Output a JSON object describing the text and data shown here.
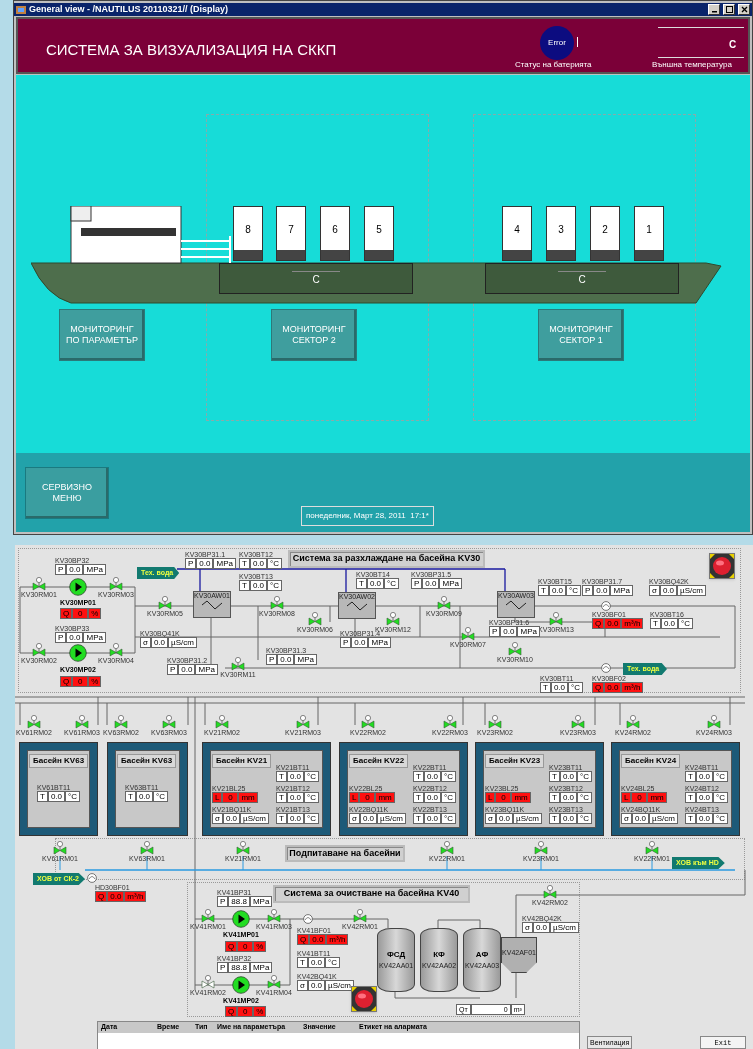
{
  "window": {
    "title": "General view - /NAUTILUS 20110321// (Display)"
  },
  "header": {
    "title": "СИСТЕМА ЗА ВИЗУАЛИЗАЦИЯ НА СККП",
    "battery": {
      "status": "Error",
      "label": "Статус на батерията"
    },
    "outside_temp": {
      "value": "C",
      "label": "Външна температура"
    }
  },
  "ship": {
    "containers": [
      {
        "number": "8"
      },
      {
        "number": "7"
      },
      {
        "number": "6"
      },
      {
        "number": "5"
      },
      {
        "number": "4"
      },
      {
        "number": "3"
      },
      {
        "number": "2"
      },
      {
        "number": "1"
      }
    ],
    "sector_readings": [
      "C",
      "C"
    ]
  },
  "monitor_buttons": [
    "МОНИТОРИНГ ПО ПАРАМЕТЪР",
    "МОНИТОРИНГ СЕКТОР 2",
    "МОНИТОРИНГ СЕКТОР 1"
  ],
  "service_button": "СЕРВИЗНО МЕНЮ",
  "datetime": "понеделник, Март 28, 2011  17:1*",
  "cooling": {
    "title": "Система за разхлаждане на басейна KV30",
    "tech_water": [
      "Тех. вода",
      "Тех. вода"
    ],
    "pumps": [
      {
        "tag": "KV30MP01",
        "running": true,
        "reading": {
          "symbol": "Q",
          "value": "0",
          "unit": "%",
          "alarm": true
        }
      },
      {
        "tag": "KV30MP02",
        "running": true,
        "reading": {
          "symbol": "Q",
          "value": "0",
          "unit": "%",
          "alarm": true
        }
      }
    ],
    "exchangers": [
      "KV30AW01",
      "KV30AW02",
      "KV30AW03"
    ],
    "valves": [
      {
        "tag": "KV30RM01",
        "open": true
      },
      {
        "tag": "KV30RM03",
        "open": true
      },
      {
        "tag": "KV30RM02",
        "open": true
      },
      {
        "tag": "KV30RM04",
        "open": true
      },
      {
        "tag": "KV30RM05",
        "open": true
      },
      {
        "tag": "KV30RM08",
        "open": true
      },
      {
        "tag": "KV30RM06",
        "open": true
      },
      {
        "tag": "KV30RM11",
        "open": true
      },
      {
        "tag": "KV30RM12",
        "open": true
      },
      {
        "tag": "KV30RM09",
        "open": true
      },
      {
        "tag": "KV30RM07",
        "open": true
      },
      {
        "tag": "KV30RM10",
        "open": true
      },
      {
        "tag": "KV30RM13",
        "open": true
      }
    ],
    "readouts": [
      {
        "tag": "KV30BP32",
        "symbol": "P",
        "value": "0.0",
        "unit": "MPa",
        "alarm": false
      },
      {
        "tag": "KV30BP33",
        "symbol": "P",
        "value": "0.0",
        "unit": "MPa",
        "alarm": false
      },
      {
        "tag": "KV30BQ41K",
        "symbol": "σ",
        "value": "0.0",
        "unit": "µS/cm",
        "alarm": false
      },
      {
        "tag": "KV30BP31.1",
        "symbol": "P",
        "value": "0.0",
        "unit": "MPa",
        "alarm": false
      },
      {
        "tag": "KV30BT12",
        "symbol": "T",
        "value": "0.0",
        "unit": "°C",
        "alarm": false
      },
      {
        "tag": "KV30BT13",
        "symbol": "T",
        "value": "0.0",
        "unit": "°C",
        "alarm": false
      },
      {
        "tag": "KV30BP31.2",
        "symbol": "P",
        "value": "0.0",
        "unit": "MPa",
        "alarm": false
      },
      {
        "tag": "KV30BP31.3",
        "symbol": "P",
        "value": "0.0",
        "unit": "MPa",
        "alarm": false
      },
      {
        "tag": "KV30BT14",
        "symbol": "T",
        "value": "0.0",
        "unit": "°C",
        "alarm": false
      },
      {
        "tag": "KV30BP31.4",
        "symbol": "P",
        "value": "0.0",
        "unit": "MPa",
        "alarm": false
      },
      {
        "tag": "KV30BP31.5",
        "symbol": "P",
        "value": "0.0",
        "unit": "MPa",
        "alarm": false
      },
      {
        "tag": "KV30BT15",
        "symbol": "T",
        "value": "0.0",
        "unit": "°C",
        "alarm": false
      },
      {
        "tag": "KV30BP31.7",
        "symbol": "P",
        "value": "0.0",
        "unit": "MPa",
        "alarm": false
      },
      {
        "tag": "KV30BQ42K",
        "symbol": "σ",
        "value": "0.0",
        "unit": "µS/cm",
        "alarm": false
      },
      {
        "tag": "KV30BP31.6",
        "symbol": "P",
        "value": "0.0",
        "unit": "MPa",
        "alarm": false
      },
      {
        "tag": "KV30BF01",
        "symbol": "Q",
        "value": "0.0",
        "unit": "m³/h",
        "alarm": true
      },
      {
        "tag": "KV30BT16",
        "symbol": "T",
        "value": "0.0",
        "unit": "°C",
        "alarm": false
      },
      {
        "tag": "KV30BT11",
        "symbol": "T",
        "value": "0.0",
        "unit": "°C",
        "alarm": false
      },
      {
        "tag": "KV30BF02",
        "symbol": "Q",
        "value": "0.0",
        "unit": "m³/h",
        "alarm": true
      }
    ]
  },
  "pools": {
    "title": "Подпитаване на басейни",
    "inlet": "ХОВ от СК-2",
    "outlet": "ХОВ към HD",
    "basins": [
      {
        "kind": "small",
        "title": "Басейн KV63",
        "readouts": [
          {
            "tag": "KV61BT11",
            "symbol": "T",
            "value": "0.0",
            "unit": "°C",
            "alarm": false
          }
        ]
      },
      {
        "kind": "small",
        "title": "Басейн KV63",
        "readouts": [
          {
            "tag": "KV63BT11",
            "symbol": "T",
            "value": "0.0",
            "unit": "°C",
            "alarm": false
          }
        ]
      },
      {
        "kind": "large",
        "title": "Басейн KV21",
        "readouts": [
          {
            "tag": "KV21BT11",
            "symbol": "T",
            "value": "0.0",
            "unit": "°C",
            "alarm": false
          },
          {
            "tag": "KV21BL25",
            "symbol": "L",
            "value": "0",
            "unit": "mm",
            "alarm": true
          },
          {
            "tag": "KV21BT12",
            "symbol": "T",
            "value": "0.0",
            "unit": "°C",
            "alarm": false
          },
          {
            "tag": "KV21BQ11K",
            "symbol": "σ",
            "value": "0.0",
            "unit": "µS/cm",
            "alarm": false
          },
          {
            "tag": "KV21BT13",
            "symbol": "T",
            "value": "0.0",
            "unit": "°C",
            "alarm": false
          }
        ]
      },
      {
        "kind": "large",
        "title": "Басейн KV22",
        "readouts": [
          {
            "tag": "KV22BT11",
            "symbol": "T",
            "value": "0.0",
            "unit": "°C",
            "alarm": false
          },
          {
            "tag": "KV22BL25",
            "symbol": "L",
            "value": "0",
            "unit": "mm",
            "alarm": true
          },
          {
            "tag": "KV22BT12",
            "symbol": "T",
            "value": "0.0",
            "unit": "°C",
            "alarm": false
          },
          {
            "tag": "KV22BQ11K",
            "symbol": "σ",
            "value": "0.0",
            "unit": "µS/cm",
            "alarm": false
          },
          {
            "tag": "KV22BT13",
            "symbol": "T",
            "value": "0.0",
            "unit": "°C",
            "alarm": false
          }
        ]
      },
      {
        "kind": "large",
        "title": "Басейн KV23",
        "readouts": [
          {
            "tag": "KV23BT11",
            "symbol": "T",
            "value": "0.0",
            "unit": "°C",
            "alarm": false
          },
          {
            "tag": "KV23BL25",
            "symbol": "L",
            "value": "0",
            "unit": "mm",
            "alarm": true
          },
          {
            "tag": "KV23BT12",
            "symbol": "T",
            "value": "0.0",
            "unit": "°C",
            "alarm": false
          },
          {
            "tag": "KV23BQ11K",
            "symbol": "σ",
            "value": "0.0",
            "unit": "µS/cm",
            "alarm": false
          },
          {
            "tag": "KV23BT13",
            "symbol": "T",
            "value": "0.0",
            "unit": "°C",
            "alarm": false
          }
        ]
      },
      {
        "kind": "large",
        "title": "Басейн KV24",
        "readouts": [
          {
            "tag": "KV24BT11",
            "symbol": "T",
            "value": "0.0",
            "unit": "°C",
            "alarm": false
          },
          {
            "tag": "KV24BL25",
            "symbol": "L",
            "value": "0",
            "unit": "mm",
            "alarm": true
          },
          {
            "tag": "KV24BT12",
            "symbol": "T",
            "value": "0.0",
            "unit": "°C",
            "alarm": false
          },
          {
            "tag": "KV24BQ11K",
            "symbol": "σ",
            "value": "0.0",
            "unit": "µS/cm",
            "alarm": false
          },
          {
            "tag": "KV24BT13",
            "symbol": "T",
            "value": "0.0",
            "unit": "°C",
            "alarm": false
          }
        ]
      }
    ],
    "valves": [
      {
        "tag": "KV61RM02",
        "open": true
      },
      {
        "tag": "KV61RM03",
        "open": true
      },
      {
        "tag": "KV63RM02",
        "open": true
      },
      {
        "tag": "KV63RM03",
        "open": true
      },
      {
        "tag": "KV21RM02",
        "open": true
      },
      {
        "tag": "KV21RM03",
        "open": true
      },
      {
        "tag": "KV22RM02",
        "open": true
      },
      {
        "tag": "KV22RM03",
        "open": true
      },
      {
        "tag": "KV23RM02",
        "open": true
      },
      {
        "tag": "KV23RM03",
        "open": true
      },
      {
        "tag": "KV24RM02",
        "open": true
      },
      {
        "tag": "KV24RM03",
        "open": true
      },
      {
        "tag": "KV61RM01",
        "open": true
      },
      {
        "tag": "KV63RM01",
        "open": true
      },
      {
        "tag": "KV21RM01",
        "open": true
      },
      {
        "tag": "KV22RM01",
        "open": true
      },
      {
        "tag": "KV23RM01",
        "open": true
      },
      {
        "tag": "KV22RM01",
        "open": true
      }
    ],
    "readouts": [
      {
        "tag": "HD30BF01",
        "symbol": "Q",
        "value": "0.0",
        "unit": "m³/h",
        "alarm": true
      }
    ]
  },
  "cleaning": {
    "title": "Система за очистване на басейна KV40",
    "pumps": [
      {
        "tag": "KV41MP01",
        "running": true,
        "reading": {
          "symbol": "Q",
          "value": "0",
          "unit": "%",
          "alarm": true
        }
      },
      {
        "tag": "KV41MP02",
        "running": true,
        "reading": {
          "symbol": "Q",
          "value": "0",
          "unit": "%",
          "alarm": true
        }
      }
    ],
    "valves": [
      {
        "tag": "KV41RM01",
        "open": true
      },
      {
        "tag": "KV41RM03",
        "open": true
      },
      {
        "tag": "KV41RM02",
        "open": false
      },
      {
        "tag": "KV41RM04",
        "open": true
      },
      {
        "tag": "KV42RM01",
        "open": true
      },
      {
        "tag": "KV42RM02",
        "open": true
      }
    ],
    "readouts": [
      {
        "tag": "KV41BP31",
        "symbol": "P",
        "value": "88.8",
        "unit": "MPa",
        "alarm": false
      },
      {
        "tag": "KV41BP32",
        "symbol": "P",
        "value": "88.8",
        "unit": "MPa",
        "alarm": false
      },
      {
        "tag": "KV41BF01",
        "symbol": "Q",
        "value": "0.0",
        "unit": "m³/h",
        "alarm": true
      },
      {
        "tag": "KV41BT11",
        "symbol": "T",
        "value": "0.0",
        "unit": "°C",
        "alarm": false
      },
      {
        "tag": "KV42BQ41K",
        "symbol": "σ",
        "value": "0.0",
        "unit": "µS/cm",
        "alarm": false
      },
      {
        "tag": "KV42BQ42K",
        "symbol": "σ",
        "value": "0.0",
        "unit": "µS/cm",
        "alarm": false
      }
    ],
    "tanks": [
      {
        "name": "ФСД",
        "tag": "KV42AA01"
      },
      {
        "name": "КФ",
        "tag": "KV42AA02"
      },
      {
        "name": "АФ",
        "tag": "KV42AA03"
      }
    ],
    "filter": "KV42AF01",
    "total": {
      "symbol": "Qт",
      "value": "0",
      "unit": "m³"
    }
  },
  "alarm_table": {
    "columns": [
      "Дата",
      "Време",
      "Тип",
      "Име на параметъра",
      "Значение",
      "Етикет на алармата"
    ]
  },
  "buttons": [
    "Вентилация",
    "Exit"
  ]
}
